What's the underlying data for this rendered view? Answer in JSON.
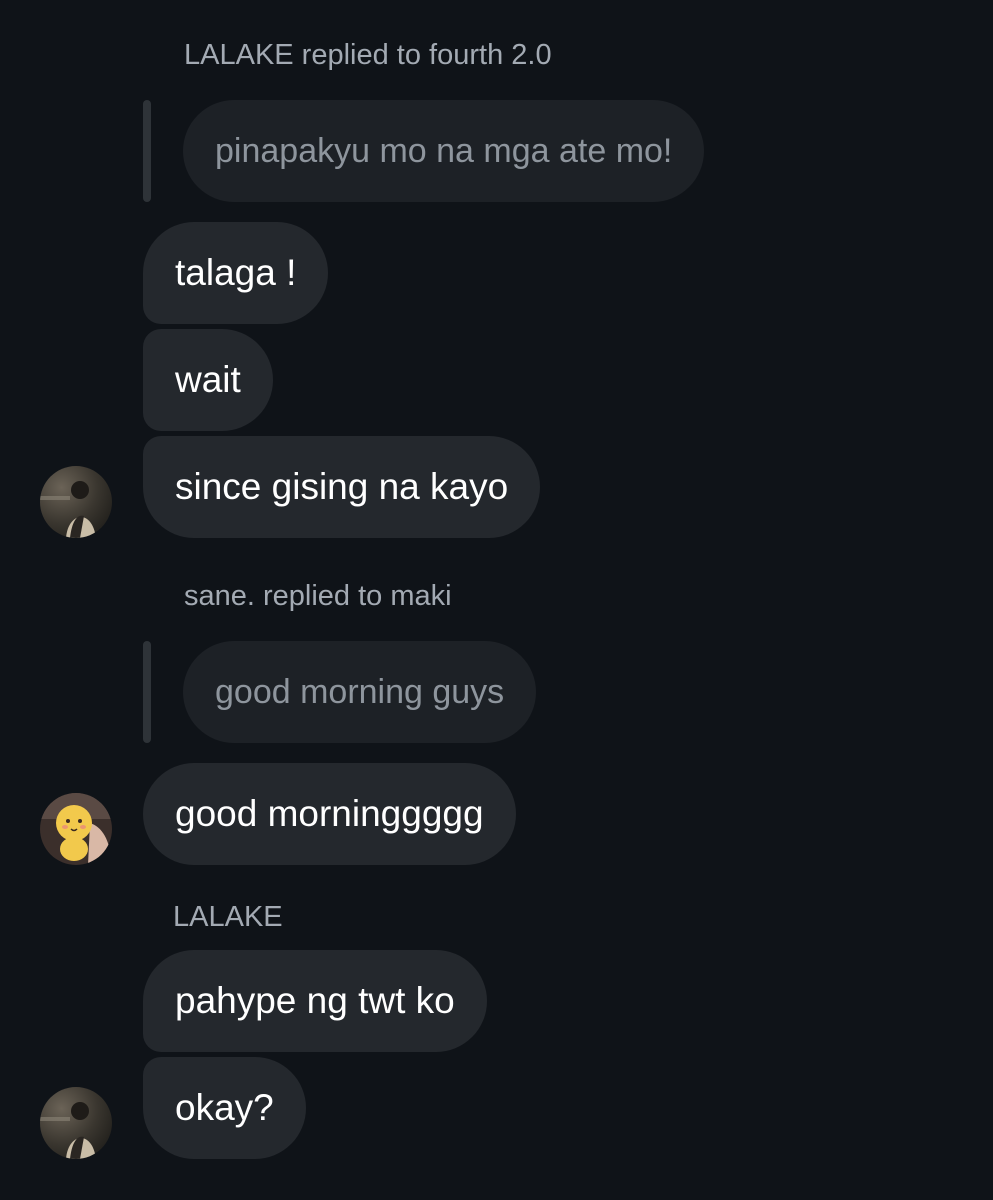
{
  "thread": [
    {
      "reply_header": "LALAKE replied to fourth 2.0",
      "quoted_text": "pinapakyu mo na mga ate mo!",
      "messages": [
        "talaga !",
        "wait",
        "since gising na kayo"
      ],
      "avatar_icon": "person-photo-avatar"
    },
    {
      "reply_header": "sane. replied to maki",
      "quoted_text": "good morning guys",
      "messages": [
        "good morninggggg"
      ],
      "avatar_icon": "plush-toy-photo-avatar"
    },
    {
      "sender_name": "LALAKE",
      "messages": [
        "pahype ng twt ko",
        "okay?"
      ],
      "avatar_icon": "person-photo-avatar"
    }
  ],
  "colors": {
    "background": "#0f1318",
    "bubble": "#24282d",
    "quote_bubble": "#1d2126",
    "meta_text": "#a3aab3"
  }
}
